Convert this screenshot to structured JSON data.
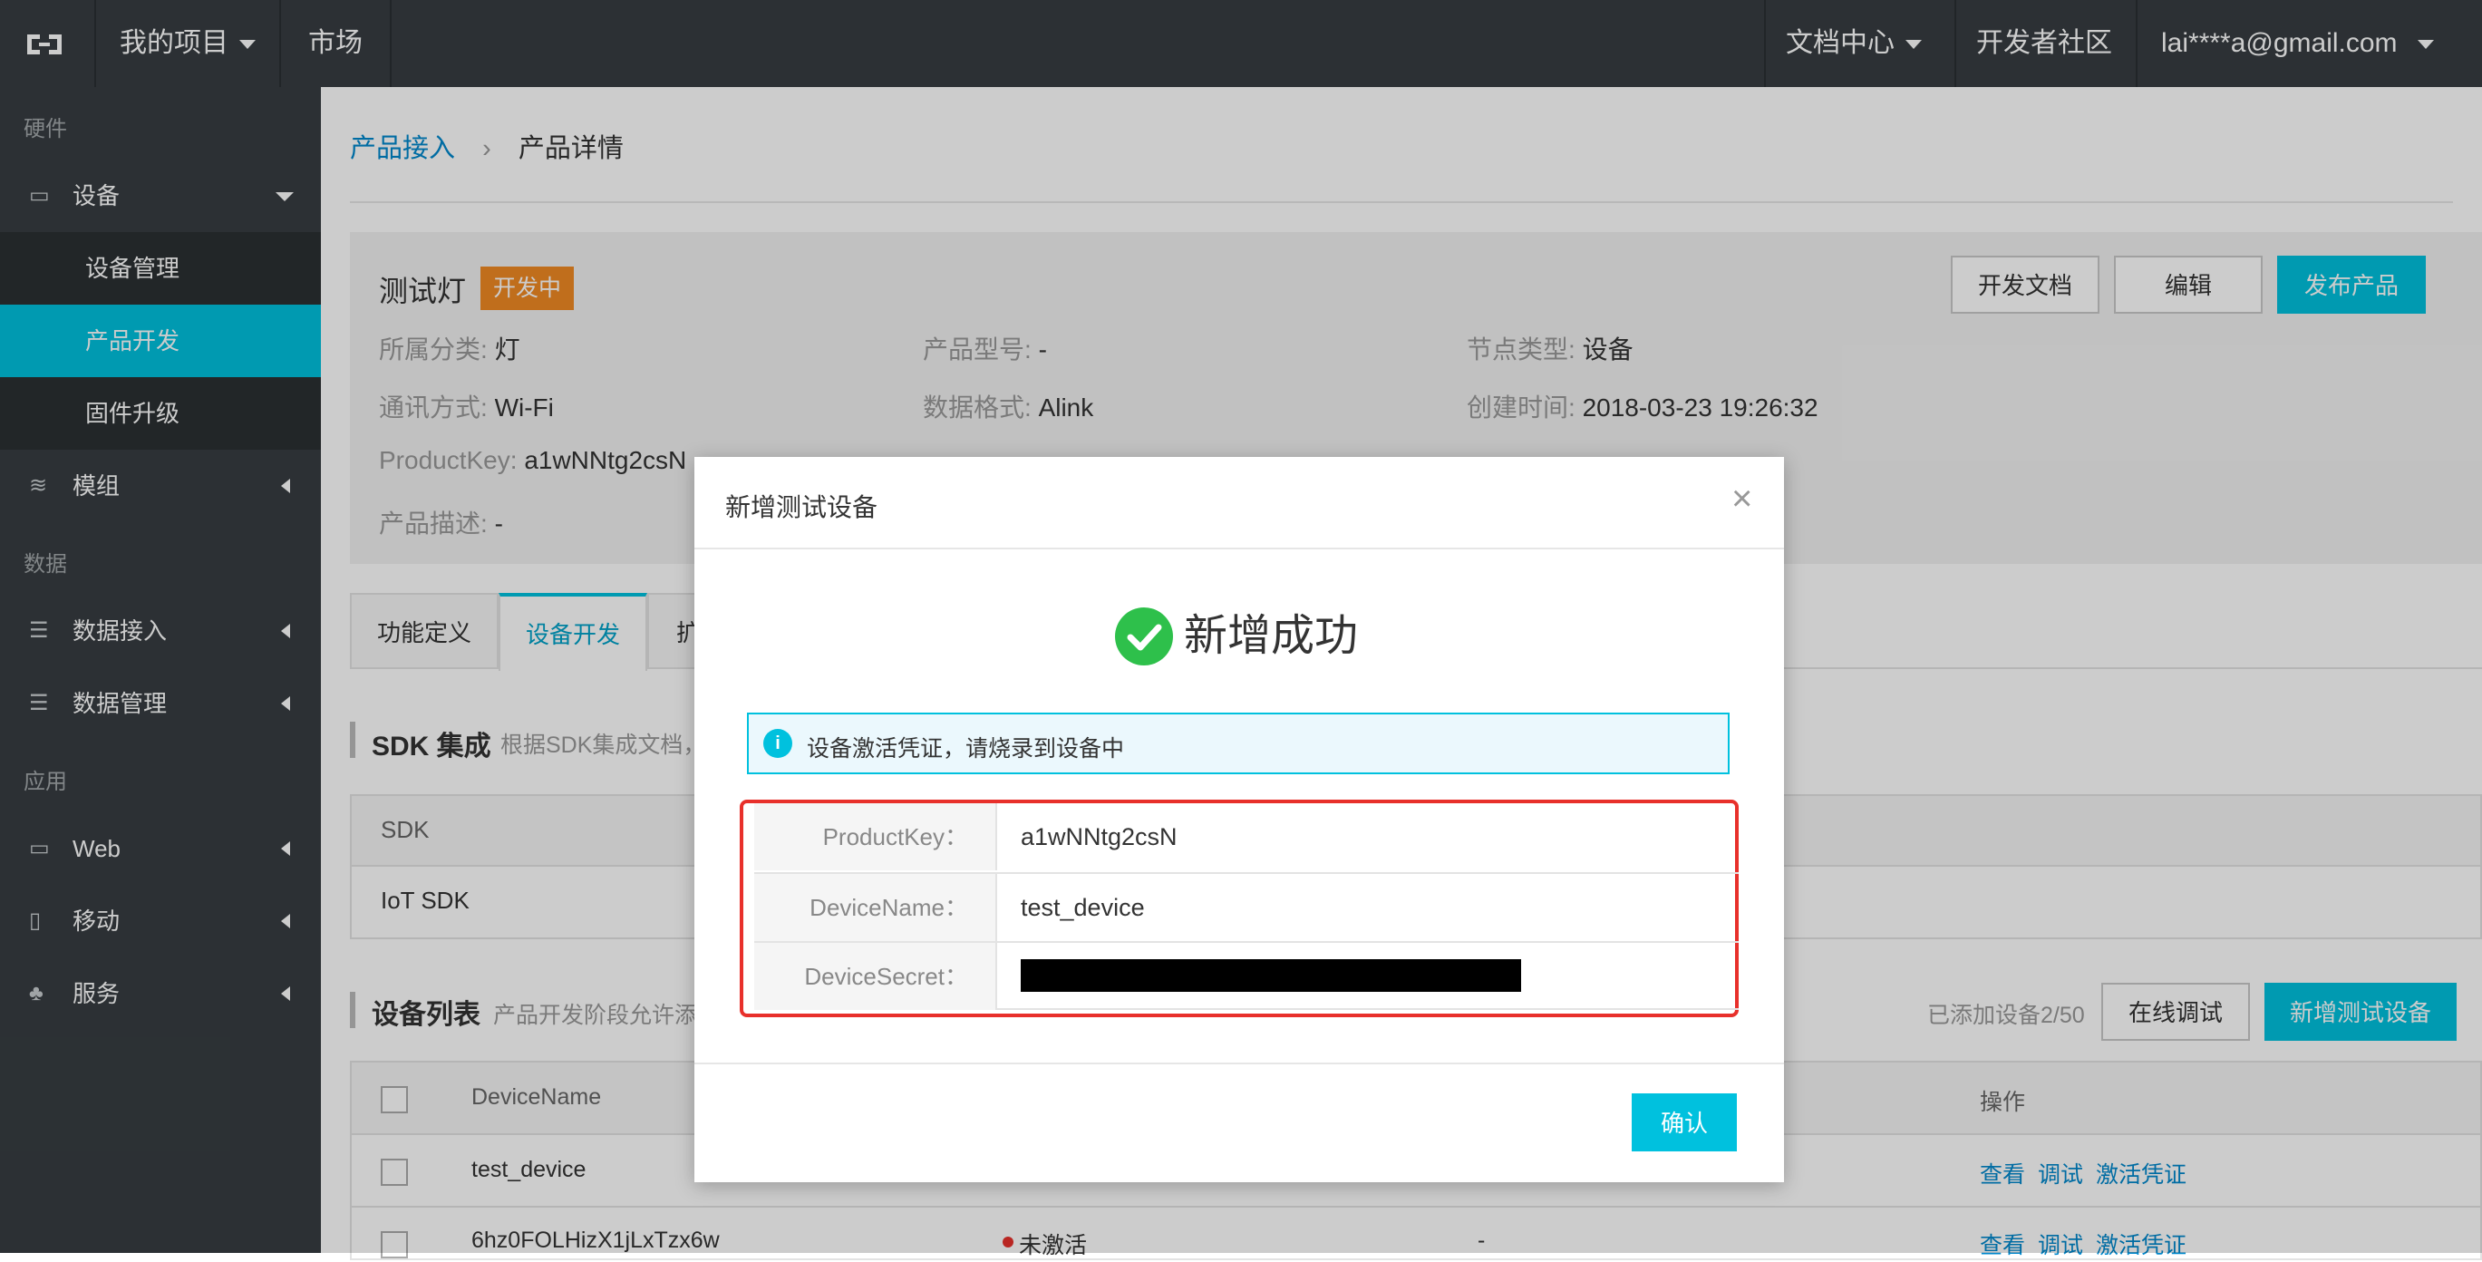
{
  "topbar": {
    "my_projects": "我的项目",
    "market": "市场",
    "docs_center": "文档中心",
    "dev_community": "开发者社区",
    "user_email": "lai****a@gmail.com"
  },
  "sidebar": {
    "group_hardware": "硬件",
    "device": "设备",
    "device_mgmt": "设备管理",
    "product_dev": "产品开发",
    "firmware": "固件升级",
    "module": "模组",
    "group_data": "数据",
    "data_access": "数据接入",
    "data_mgmt": "数据管理",
    "group_app": "应用",
    "web": "Web",
    "mobile": "移动",
    "service": "服务"
  },
  "breadcrumb": {
    "parent": "产品接入",
    "current": "产品详情"
  },
  "product": {
    "name": "测试灯",
    "status_badge": "开发中",
    "btn_docs": "开发文档",
    "btn_edit": "编辑",
    "btn_publish": "发布产品",
    "category_label": "所属分类:",
    "category_value": "灯",
    "model_label": "产品型号:",
    "model_value": "-",
    "node_label": "节点类型:",
    "node_value": "设备",
    "comm_label": "通讯方式:",
    "comm_value": "Wi-Fi",
    "format_label": "数据格式:",
    "format_value": "Alink",
    "created_label": "创建时间:",
    "created_value": "2018-03-23 19:26:32",
    "pk_label": "ProductKey:",
    "pk_value": "a1wNNtg2csN",
    "desc_label": "产品描述:",
    "desc_value": "-"
  },
  "tabs": {
    "func_def": "功能定义",
    "device_dev": "设备开发",
    "ext": "扩"
  },
  "sdk": {
    "title": "SDK 集成",
    "subtitle": "根据SDK集成文档，",
    "col_sdk": "SDK",
    "row_iot": "IoT SDK"
  },
  "device_list": {
    "title": "设备列表",
    "subtitle": "产品开发阶段允许添加",
    "count": "已添加设备2/50",
    "btn_debug": "在线调试",
    "btn_add": "新增测试设备",
    "col_name": "DeviceName",
    "col_ops": "操作",
    "rows": [
      {
        "name": "test_device",
        "status": "",
        "ops": [
          "查看",
          "调试",
          "激活凭证"
        ]
      },
      {
        "name": "6hz0FOLHizX1jLxTzx6w",
        "status": "未激活",
        "extra": "-",
        "ops": [
          "查看",
          "调试",
          "激活凭证"
        ]
      }
    ]
  },
  "modal": {
    "title": "新增测试设备",
    "success_text": "新增成功",
    "info_text": "设备激活凭证，请烧录到设备中",
    "pk_label": "ProductKey：",
    "pk_value": "a1wNNtg2csN",
    "dn_label": "DeviceName：",
    "dn_value": "test_device",
    "ds_label": "DeviceSecret：",
    "confirm": "确认"
  },
  "colors": {
    "accent": "#00c1de",
    "highlight_red": "#e8302b",
    "success_green": "#2ec04b",
    "badge_orange": "#f08a24"
  }
}
